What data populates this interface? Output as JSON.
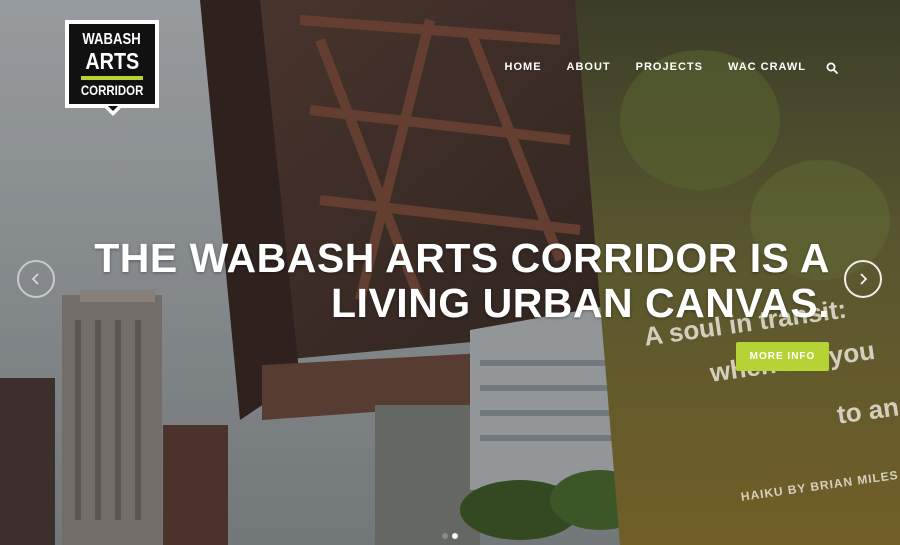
{
  "logo": {
    "line1": "WABASH",
    "line2": "ARTS",
    "line3": "CORRIDOR"
  },
  "nav": {
    "items": [
      {
        "label": "HOME"
      },
      {
        "label": "ABOUT"
      },
      {
        "label": "PROJECTS"
      },
      {
        "label": "WAC CRAWL"
      }
    ],
    "search_icon": "search-icon"
  },
  "hero": {
    "headline_line1": "THE WABASH ARTS CORRIDOR IS A",
    "headline_line2": "LIVING URBAN CANVAS.",
    "cta_label": "MORE INFO",
    "sign_line1": "A soul in transit:",
    "sign_line2": "when are you",
    "sign_line3": "to an",
    "sign_credit": "HAIKU BY BRIAN MILES",
    "prev_icon": "chevron-left-icon",
    "next_icon": "chevron-right-icon",
    "slides": 2,
    "active_slide": 2
  },
  "colors": {
    "accent": "#b5d334",
    "logo_bg": "#111111",
    "dot_inactive": "#8a8a8a",
    "dot_active": "#ffffff"
  }
}
